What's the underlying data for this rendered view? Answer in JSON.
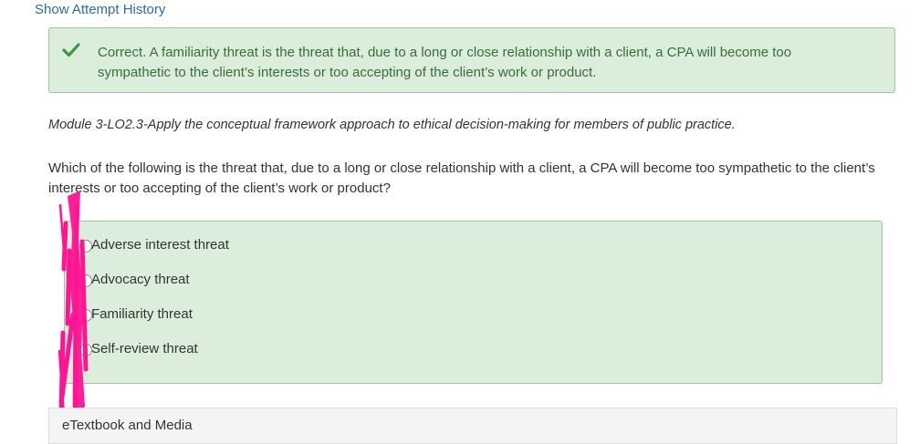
{
  "history_link": "Show Attempt History",
  "feedback": {
    "text": "Correct. A familiarity threat is the threat that, due to a long or close relationship with a client, a CPA will become too sympathetic to the client’s interests or too accepting of the client’s work or product.",
    "icon": "check-icon",
    "color": "#3c9a3c"
  },
  "module": "Module 3-LO2.3-Apply the conceptual framework approach to ethical decision-making for members of public practice.",
  "question": "Which of the following is the threat that, due to a long or close relationship with a client, a CPA will become too sympathetic to the client’s interests or too accepting of the client’s work or product?",
  "options": [
    "Adverse interest threat",
    "Advocacy threat",
    "Familiarity threat",
    "Self-review threat"
  ],
  "etextbook": "eTextbook and Media",
  "annotation_color": "#ff1493"
}
